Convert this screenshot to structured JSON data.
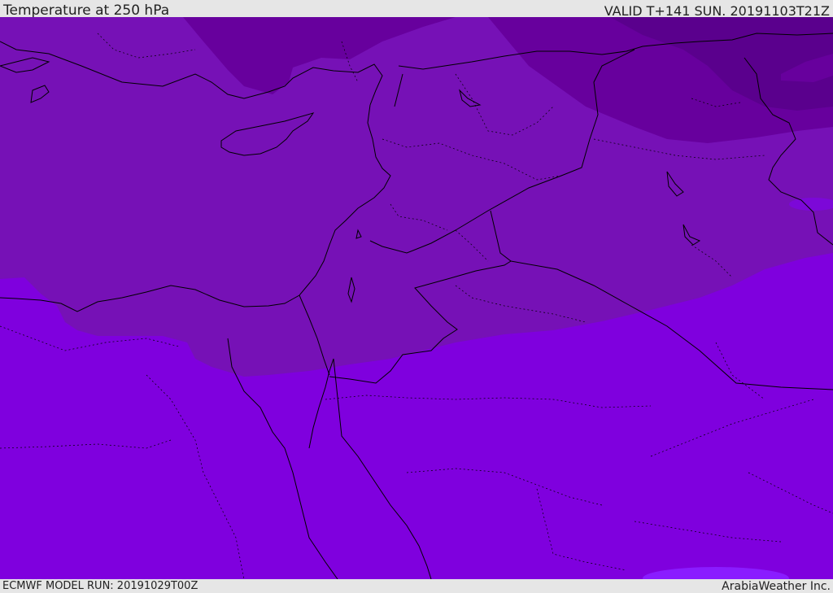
{
  "header": {
    "title": "Temperature at 250 hPa",
    "valid_time": "VALID T+141 SUN. 20191103T21Z"
  },
  "footer": {
    "model_run": "ECMWF MODEL RUN: 20191029T00Z",
    "brand": "ArabiaWeather Inc."
  },
  "colors": {
    "band_warm": "#7f00de",
    "band_mid": "#7611b6",
    "band_cold": "#67009d",
    "band_coldest": "#5a008d",
    "band_hot_patch": "#8a1cff",
    "border_line": "#000000"
  }
}
